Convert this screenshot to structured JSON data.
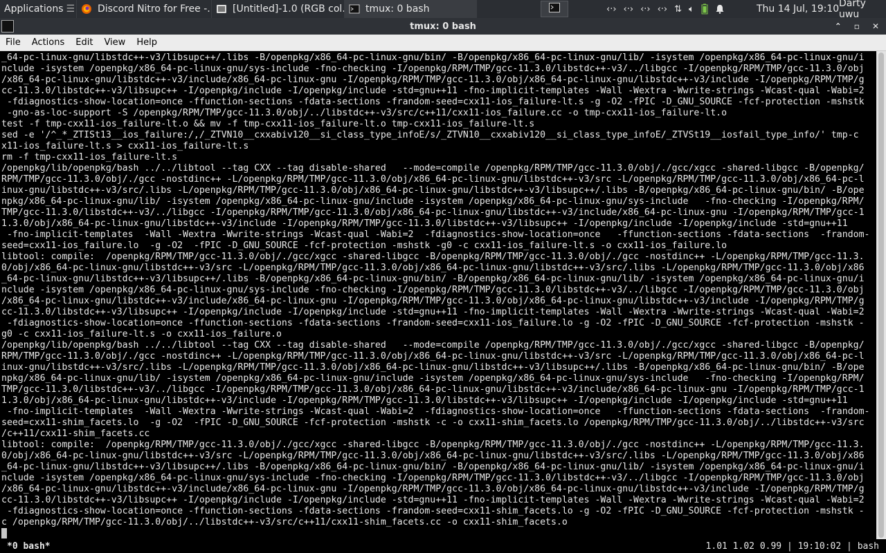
{
  "panel": {
    "apps_label": "Applications",
    "apps_sep": "☰",
    "tasks": [
      {
        "label": "Discord Nitro for Free -...",
        "icon": "firefox-icon"
      },
      {
        "label": "[Untitled]-1.0 (RGB col...",
        "icon": "gimp-icon"
      },
      {
        "label": "tmux: 0 bash",
        "icon": "terminal-icon"
      }
    ],
    "clock": "Thu 14 Jul, 19:10",
    "user": "Darty uwu"
  },
  "window": {
    "title": "tmux: 0 bash",
    "min": "⌃",
    "max": "▫",
    "close": "✕"
  },
  "menu": [
    "File",
    "Actions",
    "Edit",
    "View",
    "Help"
  ],
  "terminal": {
    "lines": [
      "_64-pc-linux-gnu/libstdc++-v3/libsupc++/.libs -B/openpkg/x86_64-pc-linux-gnu/bin/ -B/openpkg/x86_64-pc-linux-gnu/lib/ -isystem /openpkg/x86_64-pc-linux-gnu/i",
      "nclude -isystem /openpkg/x86_64-pc-linux-gnu/sys-include -fno-checking -I/openpkg/RPM/TMP/gcc-11.3.0/libstdc++-v3/../libgcc -I/openpkg/RPM/TMP/gcc-11.3.0/obj",
      "/x86_64-pc-linux-gnu/libstdc++-v3/include/x86_64-pc-linux-gnu -I/openpkg/RPM/TMP/gcc-11.3.0/obj/x86_64-pc-linux-gnu/libstdc++-v3/include -I/openpkg/RPM/TMP/g",
      "cc-11.3.0/libstdc++-v3/libsupc++ -I/openpkg/include -I/openpkg/include -std=gnu++11 -fno-implicit-templates -Wall -Wextra -Wwrite-strings -Wcast-qual -Wabi=2",
      " -fdiagnostics-show-location=once -ffunction-sections -fdata-sections -frandom-seed=cxx11-ios_failure-lt.s -g -O2 -fPIC -D_GNU_SOURCE -fcf-protection -mshstk",
      " -gno-as-loc-support -S /openpkg/RPM/TMP/gcc-11.3.0/obj/../libstdc++-v3/src/c++11/cxx11-ios_failure.cc -o tmp-cxx11-ios_failure-lt.o",
      "test -f tmp-cxx11-ios_failure-lt.o && mv -f tmp-cxx11-ios_failure-lt.o tmp-cxx11-ios_failure-lt.s",
      "sed -e '/^_*_ZTISt13__ios_failure:/,/_ZTVN10__cxxabiv120__si_class_type_infoE/s/_ZTVN10__cxxabiv120__si_class_type_infoE/_ZTVSt19__iosfail_type_info/' tmp-c",
      "x11-ios_failure-lt.s > cxx11-ios_failure-lt.s",
      "rm -f tmp-cxx11-ios_failure-lt.s",
      "/openpkg/lib/openpkg/bash ../../libtool --tag CXX --tag disable-shared   --mode=compile /openpkg/RPM/TMP/gcc-11.3.0/obj/./gcc/xgcc -shared-libgcc -B/openpkg/",
      "RPM/TMP/gcc-11.3.0/obj/./gcc -nostdinc++ -L/openpkg/RPM/TMP/gcc-11.3.0/obj/x86_64-pc-linux-gnu/libstdc++-v3/src -L/openpkg/RPM/TMP/gcc-11.3.0/obj/x86_64-pc-l",
      "inux-gnu/libstdc++-v3/src/.libs -L/openpkg/RPM/TMP/gcc-11.3.0/obj/x86_64-pc-linux-gnu/libstdc++-v3/libsupc++/.libs -B/openpkg/x86_64-pc-linux-gnu/bin/ -B/ope",
      "npkg/x86_64-pc-linux-gnu/lib/ -isystem /openpkg/x86_64-pc-linux-gnu/include -isystem /openpkg/x86_64-pc-linux-gnu/sys-include   -fno-checking -I/openpkg/RPM/",
      "TMP/gcc-11.3.0/libstdc++-v3/../libgcc -I/openpkg/RPM/TMP/gcc-11.3.0/obj/x86_64-pc-linux-gnu/libstdc++-v3/include/x86_64-pc-linux-gnu -I/openpkg/RPM/TMP/gcc-1",
      "1.3.0/obj/x86_64-pc-linux-gnu/libstdc++-v3/include -I/openpkg/RPM/TMP/gcc-11.3.0/libstdc++-v3/libsupc++ -I/openpkg/include -I/openpkg/include -std=gnu++11",
      " -fno-implicit-templates  -Wall -Wextra -Wwrite-strings -Wcast-qual -Wabi=2  -fdiagnostics-show-location=once   -ffunction-sections -fdata-sections  -frandom-",
      "seed=cxx11-ios_failure.lo  -g -O2  -fPIC -D_GNU_SOURCE -fcf-protection -mshstk -g0 -c cxx11-ios_failure-lt.s -o cxx11-ios_failure.lo",
      "libtool: compile:  /openpkg/RPM/TMP/gcc-11.3.0/obj/./gcc/xgcc -shared-libgcc -B/openpkg/RPM/TMP/gcc-11.3.0/obj/./gcc -nostdinc++ -L/openpkg/RPM/TMP/gcc-11.3.",
      "0/obj/x86_64-pc-linux-gnu/libstdc++-v3/src -L/openpkg/RPM/TMP/gcc-11.3.0/obj/x86_64-pc-linux-gnu/libstdc++-v3/src/.libs -L/openpkg/RPM/TMP/gcc-11.3.0/obj/x86",
      "_64-pc-linux-gnu/libstdc++-v3/libsupc++/.libs -B/openpkg/x86_64-pc-linux-gnu/bin/ -B/openpkg/x86_64-pc-linux-gnu/lib/ -isystem /openpkg/x86_64-pc-linux-gnu/i",
      "nclude -isystem /openpkg/x86_64-pc-linux-gnu/sys-include -fno-checking -I/openpkg/RPM/TMP/gcc-11.3.0/libstdc++-v3/../libgcc -I/openpkg/RPM/TMP/gcc-11.3.0/obj",
      "/x86_64-pc-linux-gnu/libstdc++-v3/include/x86_64-pc-linux-gnu -I/openpkg/RPM/TMP/gcc-11.3.0/obj/x86_64-pc-linux-gnu/libstdc++-v3/include -I/openpkg/RPM/TMP/g",
      "cc-11.3.0/libstdc++-v3/libsupc++ -I/openpkg/include -I/openpkg/include -std=gnu++11 -fno-implicit-templates -Wall -Wextra -Wwrite-strings -Wcast-qual -Wabi=2",
      " -fdiagnostics-show-location=once -ffunction-sections -fdata-sections -frandom-seed=cxx11-ios_failure.lo -g -O2 -fPIC -D_GNU_SOURCE -fcf-protection -mshstk -",
      "g0 -c cxx11-ios_failure-lt.s -o cxx11-ios_failure.o",
      "/openpkg/lib/openpkg/bash ../../libtool --tag CXX --tag disable-shared   --mode=compile /openpkg/RPM/TMP/gcc-11.3.0/obj/./gcc/xgcc -shared-libgcc -B/openpkg/",
      "RPM/TMP/gcc-11.3.0/obj/./gcc -nostdinc++ -L/openpkg/RPM/TMP/gcc-11.3.0/obj/x86_64-pc-linux-gnu/libstdc++-v3/src -L/openpkg/RPM/TMP/gcc-11.3.0/obj/x86_64-pc-l",
      "inux-gnu/libstdc++-v3/src/.libs -L/openpkg/RPM/TMP/gcc-11.3.0/obj/x86_64-pc-linux-gnu/libstdc++-v3/libsupc++/.libs -B/openpkg/x86_64-pc-linux-gnu/bin/ -B/ope",
      "npkg/x86_64-pc-linux-gnu/lib/ -isystem /openpkg/x86_64-pc-linux-gnu/include -isystem /openpkg/x86_64-pc-linux-gnu/sys-include   -fno-checking -I/openpkg/RPM/",
      "TMP/gcc-11.3.0/libstdc++-v3/../libgcc -I/openpkg/RPM/TMP/gcc-11.3.0/obj/x86_64-pc-linux-gnu/libstdc++-v3/include/x86_64-pc-linux-gnu -I/openpkg/RPM/TMP/gcc-1",
      "1.3.0/obj/x86_64-pc-linux-gnu/libstdc++-v3/include -I/openpkg/RPM/TMP/gcc-11.3.0/libstdc++-v3/libsupc++ -I/openpkg/include -I/openpkg/include -std=gnu++11",
      " -fno-implicit-templates  -Wall -Wextra -Wwrite-strings -Wcast-qual -Wabi=2  -fdiagnostics-show-location=once   -ffunction-sections -fdata-sections  -frandom-",
      "seed=cxx11-shim_facets.lo  -g -O2  -fPIC -D_GNU_SOURCE -fcf-protection -mshstk -c -o cxx11-shim_facets.lo /openpkg/RPM/TMP/gcc-11.3.0/obj/../libstdc++-v3/src",
      "/c++11/cxx11-shim_facets.cc",
      "libtool: compile:  /openpkg/RPM/TMP/gcc-11.3.0/obj/./gcc/xgcc -shared-libgcc -B/openpkg/RPM/TMP/gcc-11.3.0/obj/./gcc -nostdinc++ -L/openpkg/RPM/TMP/gcc-11.3.",
      "0/obj/x86_64-pc-linux-gnu/libstdc++-v3/src -L/openpkg/RPM/TMP/gcc-11.3.0/obj/x86_64-pc-linux-gnu/libstdc++-v3/src/.libs -L/openpkg/RPM/TMP/gcc-11.3.0/obj/x86",
      "_64-pc-linux-gnu/libstdc++-v3/libsupc++/.libs -B/openpkg/x86_64-pc-linux-gnu/bin/ -B/openpkg/x86_64-pc-linux-gnu/lib/ -isystem /openpkg/x86_64-pc-linux-gnu/i",
      "nclude -isystem /openpkg/x86_64-pc-linux-gnu/sys-include -fno-checking -I/openpkg/RPM/TMP/gcc-11.3.0/libstdc++-v3/../libgcc -I/openpkg/RPM/TMP/gcc-11.3.0/obj",
      "/x86_64-pc-linux-gnu/libstdc++-v3/include/x86_64-pc-linux-gnu -I/openpkg/RPM/TMP/gcc-11.3.0/obj/x86_64-pc-linux-gnu/libstdc++-v3/include -I/openpkg/RPM/TMP/g",
      "cc-11.3.0/libstdc++-v3/libsupc++ -I/openpkg/include -I/openpkg/include -std=gnu++11 -fno-implicit-templates -Wall -Wextra -Wwrite-strings -Wcast-qual -Wabi=2",
      " -fdiagnostics-show-location=once -ffunction-sections -fdata-sections -frandom-seed=cxx11-shim_facets.lo -g -O2 -fPIC -D_GNU_SOURCE -fcf-protection -mshstk -",
      "c /openpkg/RPM/TMP/gcc-11.3.0/obj/../libstdc++-v3/src/c++11/cxx11-shim_facets.cc -o cxx11-shim_facets.o"
    ]
  },
  "status": {
    "left": "*0 bash*",
    "right": "1.01 1.02 0.99 | 19:10:02 | bash"
  },
  "colors": {
    "panel_bg": "#2b2e33",
    "terminal_bg": "#000000",
    "terminal_fg": "#e8e8e8",
    "menubar_bg": "#ececec"
  }
}
